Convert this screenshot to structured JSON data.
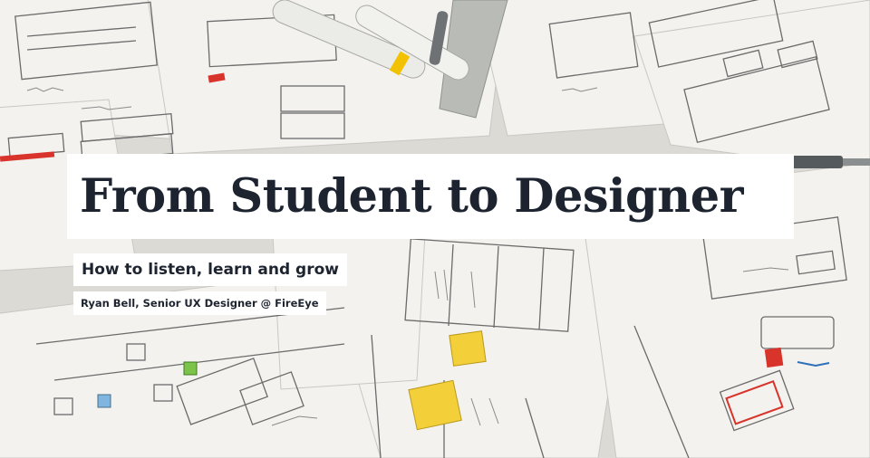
{
  "hero": {
    "background_description_icon": "sketch-paper-background",
    "title": "From Student to Designer",
    "subtitle": "How to listen, learn and grow",
    "byline": "Ryan Bell, Senior UX Designer @ FireEye"
  },
  "colors": {
    "text": "#1d2430",
    "label_background": "#ffffff",
    "paper": "#f2f1ee",
    "sticky_note": "#f3cf3a",
    "red_marker": "#d9342b"
  }
}
